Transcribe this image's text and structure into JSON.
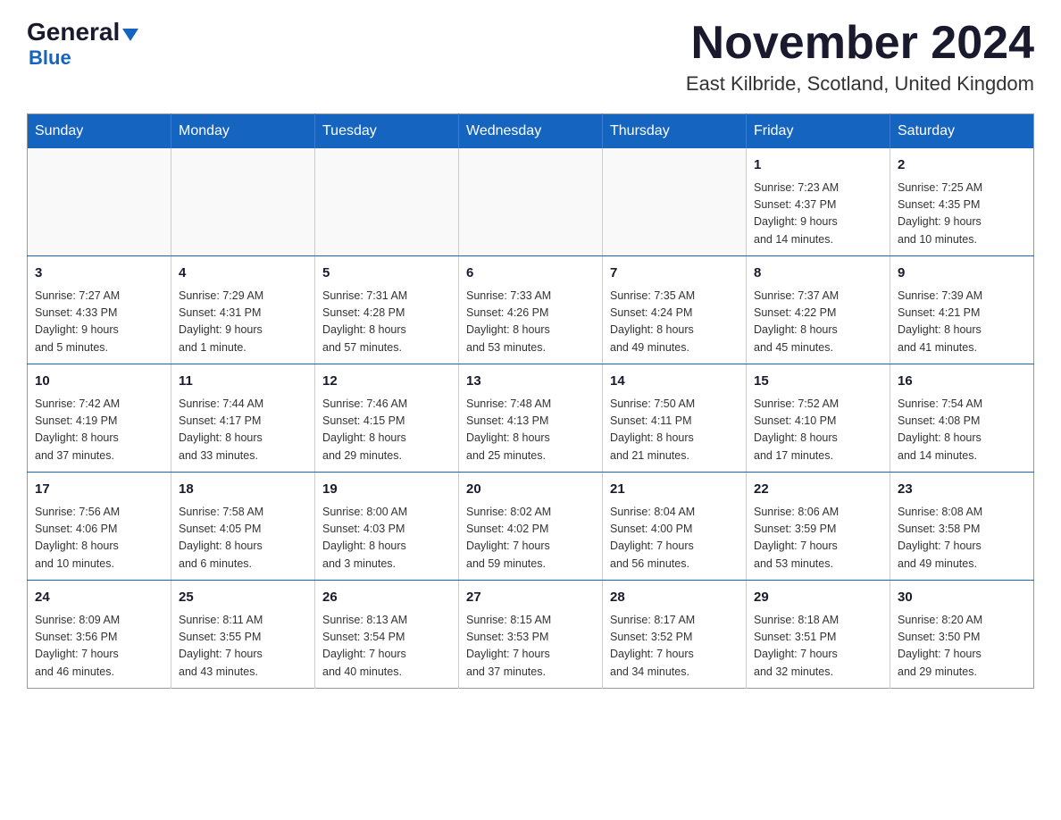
{
  "header": {
    "logo": {
      "part1": "General",
      "part2": "Blue"
    },
    "title": "November 2024",
    "subtitle": "East Kilbride, Scotland, United Kingdom"
  },
  "calendar": {
    "weekdays": [
      "Sunday",
      "Monday",
      "Tuesday",
      "Wednesday",
      "Thursday",
      "Friday",
      "Saturday"
    ],
    "weeks": [
      [
        {
          "day": "",
          "info": ""
        },
        {
          "day": "",
          "info": ""
        },
        {
          "day": "",
          "info": ""
        },
        {
          "day": "",
          "info": ""
        },
        {
          "day": "",
          "info": ""
        },
        {
          "day": "1",
          "info": "Sunrise: 7:23 AM\nSunset: 4:37 PM\nDaylight: 9 hours\nand 14 minutes."
        },
        {
          "day": "2",
          "info": "Sunrise: 7:25 AM\nSunset: 4:35 PM\nDaylight: 9 hours\nand 10 minutes."
        }
      ],
      [
        {
          "day": "3",
          "info": "Sunrise: 7:27 AM\nSunset: 4:33 PM\nDaylight: 9 hours\nand 5 minutes."
        },
        {
          "day": "4",
          "info": "Sunrise: 7:29 AM\nSunset: 4:31 PM\nDaylight: 9 hours\nand 1 minute."
        },
        {
          "day": "5",
          "info": "Sunrise: 7:31 AM\nSunset: 4:28 PM\nDaylight: 8 hours\nand 57 minutes."
        },
        {
          "day": "6",
          "info": "Sunrise: 7:33 AM\nSunset: 4:26 PM\nDaylight: 8 hours\nand 53 minutes."
        },
        {
          "day": "7",
          "info": "Sunrise: 7:35 AM\nSunset: 4:24 PM\nDaylight: 8 hours\nand 49 minutes."
        },
        {
          "day": "8",
          "info": "Sunrise: 7:37 AM\nSunset: 4:22 PM\nDaylight: 8 hours\nand 45 minutes."
        },
        {
          "day": "9",
          "info": "Sunrise: 7:39 AM\nSunset: 4:21 PM\nDaylight: 8 hours\nand 41 minutes."
        }
      ],
      [
        {
          "day": "10",
          "info": "Sunrise: 7:42 AM\nSunset: 4:19 PM\nDaylight: 8 hours\nand 37 minutes."
        },
        {
          "day": "11",
          "info": "Sunrise: 7:44 AM\nSunset: 4:17 PM\nDaylight: 8 hours\nand 33 minutes."
        },
        {
          "day": "12",
          "info": "Sunrise: 7:46 AM\nSunset: 4:15 PM\nDaylight: 8 hours\nand 29 minutes."
        },
        {
          "day": "13",
          "info": "Sunrise: 7:48 AM\nSunset: 4:13 PM\nDaylight: 8 hours\nand 25 minutes."
        },
        {
          "day": "14",
          "info": "Sunrise: 7:50 AM\nSunset: 4:11 PM\nDaylight: 8 hours\nand 21 minutes."
        },
        {
          "day": "15",
          "info": "Sunrise: 7:52 AM\nSunset: 4:10 PM\nDaylight: 8 hours\nand 17 minutes."
        },
        {
          "day": "16",
          "info": "Sunrise: 7:54 AM\nSunset: 4:08 PM\nDaylight: 8 hours\nand 14 minutes."
        }
      ],
      [
        {
          "day": "17",
          "info": "Sunrise: 7:56 AM\nSunset: 4:06 PM\nDaylight: 8 hours\nand 10 minutes."
        },
        {
          "day": "18",
          "info": "Sunrise: 7:58 AM\nSunset: 4:05 PM\nDaylight: 8 hours\nand 6 minutes."
        },
        {
          "day": "19",
          "info": "Sunrise: 8:00 AM\nSunset: 4:03 PM\nDaylight: 8 hours\nand 3 minutes."
        },
        {
          "day": "20",
          "info": "Sunrise: 8:02 AM\nSunset: 4:02 PM\nDaylight: 7 hours\nand 59 minutes."
        },
        {
          "day": "21",
          "info": "Sunrise: 8:04 AM\nSunset: 4:00 PM\nDaylight: 7 hours\nand 56 minutes."
        },
        {
          "day": "22",
          "info": "Sunrise: 8:06 AM\nSunset: 3:59 PM\nDaylight: 7 hours\nand 53 minutes."
        },
        {
          "day": "23",
          "info": "Sunrise: 8:08 AM\nSunset: 3:58 PM\nDaylight: 7 hours\nand 49 minutes."
        }
      ],
      [
        {
          "day": "24",
          "info": "Sunrise: 8:09 AM\nSunset: 3:56 PM\nDaylight: 7 hours\nand 46 minutes."
        },
        {
          "day": "25",
          "info": "Sunrise: 8:11 AM\nSunset: 3:55 PM\nDaylight: 7 hours\nand 43 minutes."
        },
        {
          "day": "26",
          "info": "Sunrise: 8:13 AM\nSunset: 3:54 PM\nDaylight: 7 hours\nand 40 minutes."
        },
        {
          "day": "27",
          "info": "Sunrise: 8:15 AM\nSunset: 3:53 PM\nDaylight: 7 hours\nand 37 minutes."
        },
        {
          "day": "28",
          "info": "Sunrise: 8:17 AM\nSunset: 3:52 PM\nDaylight: 7 hours\nand 34 minutes."
        },
        {
          "day": "29",
          "info": "Sunrise: 8:18 AM\nSunset: 3:51 PM\nDaylight: 7 hours\nand 32 minutes."
        },
        {
          "day": "30",
          "info": "Sunrise: 8:20 AM\nSunset: 3:50 PM\nDaylight: 7 hours\nand 29 minutes."
        }
      ]
    ]
  }
}
